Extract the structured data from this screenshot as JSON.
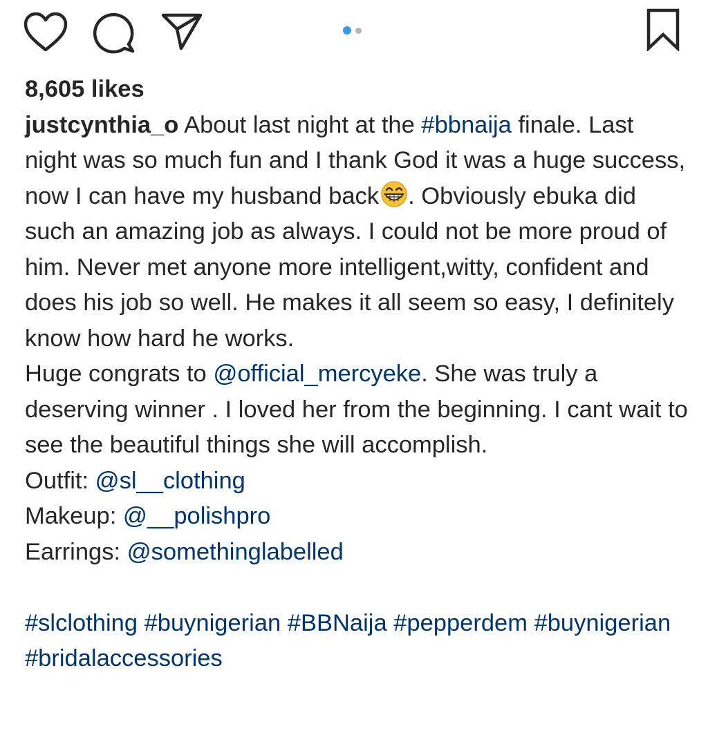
{
  "post": {
    "likes": "8,605 likes",
    "username": "justcynthia_o",
    "caption": {
      "p1_a": "About last night at the ",
      "p1_tag": "#bbnaija",
      "p1_b": " finale. Last night was so much fun and I thank God it was a huge success, now I can have my husband back",
      "p1_c": ". Obviously ebuka did such an amazing job as always. I could not be more proud of him. Never met anyone more intelligent,witty, confident and does his job so well. He makes it all seem so easy, I definitely know how hard he works.",
      "p2_a": "Huge congrats to ",
      "p2_mention": "@official_mercyeke",
      "p2_b": ". She was truly a deserving winner . I loved her from the beginning. I cant wait to see the beautiful things she will accomplish.",
      "outfit_label": "Outfit: ",
      "outfit_mention": "@sl__clothing",
      "makeup_label": "Makeup: ",
      "makeup_mention": "@__polishpro",
      "earrings_label": "Earrings: ",
      "earrings_mention": "@somethinglabelled",
      "hashtags": [
        "#slclothing",
        "#buynigerian",
        "#BBNaija",
        "#pepperdem",
        "#buynigerian",
        "#bridalaccessories"
      ]
    }
  },
  "icons": {
    "like": "heart-icon",
    "comment": "comment-icon",
    "share": "share-icon",
    "save": "bookmark-icon",
    "emoji": "grinning-emoji"
  },
  "carousel": {
    "total": 2,
    "current": 1
  },
  "colors": {
    "link": "#003569",
    "accent": "#3897f0",
    "text": "#262626"
  }
}
